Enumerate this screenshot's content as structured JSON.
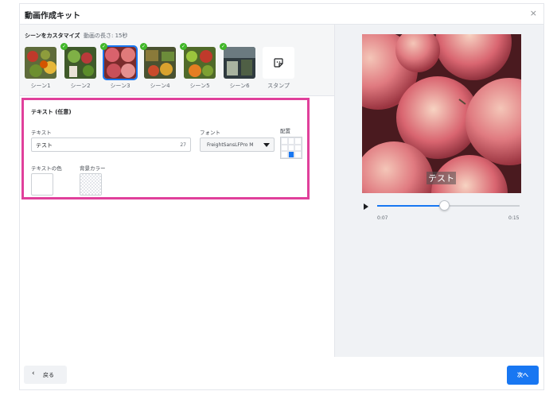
{
  "dialog": {
    "title": "動画作成キット",
    "close": "×"
  },
  "scenes": {
    "title": "シーンをカスタマイズ",
    "length": "動画の長さ: 15秒",
    "items": [
      {
        "label": "シーン1",
        "checked": false
      },
      {
        "label": "シーン2",
        "checked": true
      },
      {
        "label": "シーン3",
        "checked": true,
        "selected": true
      },
      {
        "label": "シーン4",
        "checked": true
      },
      {
        "label": "シーン5",
        "checked": true
      },
      {
        "label": "シーン6",
        "checked": true
      }
    ],
    "stamp_label": "スタンプ"
  },
  "text_panel": {
    "title": "テキスト (任意)",
    "text_label": "テキスト",
    "text_value": "テスト",
    "char_count": "27",
    "font_label": "フォント",
    "font_value": "FreightSansLFPro M",
    "position_label": "配置",
    "position_selected": "bottom-center",
    "text_color_label": "テキストの色",
    "bg_color_label": "背景カラー"
  },
  "preview": {
    "caption": "テスト",
    "time_current": "0:07",
    "time_total": "0:15",
    "progress": 0.47
  },
  "footer": {
    "back_label": "戻る",
    "next_label": "次へ"
  },
  "colors": {
    "accent": "#1877f2",
    "highlight": "#e0409b",
    "check": "#42b72a"
  }
}
